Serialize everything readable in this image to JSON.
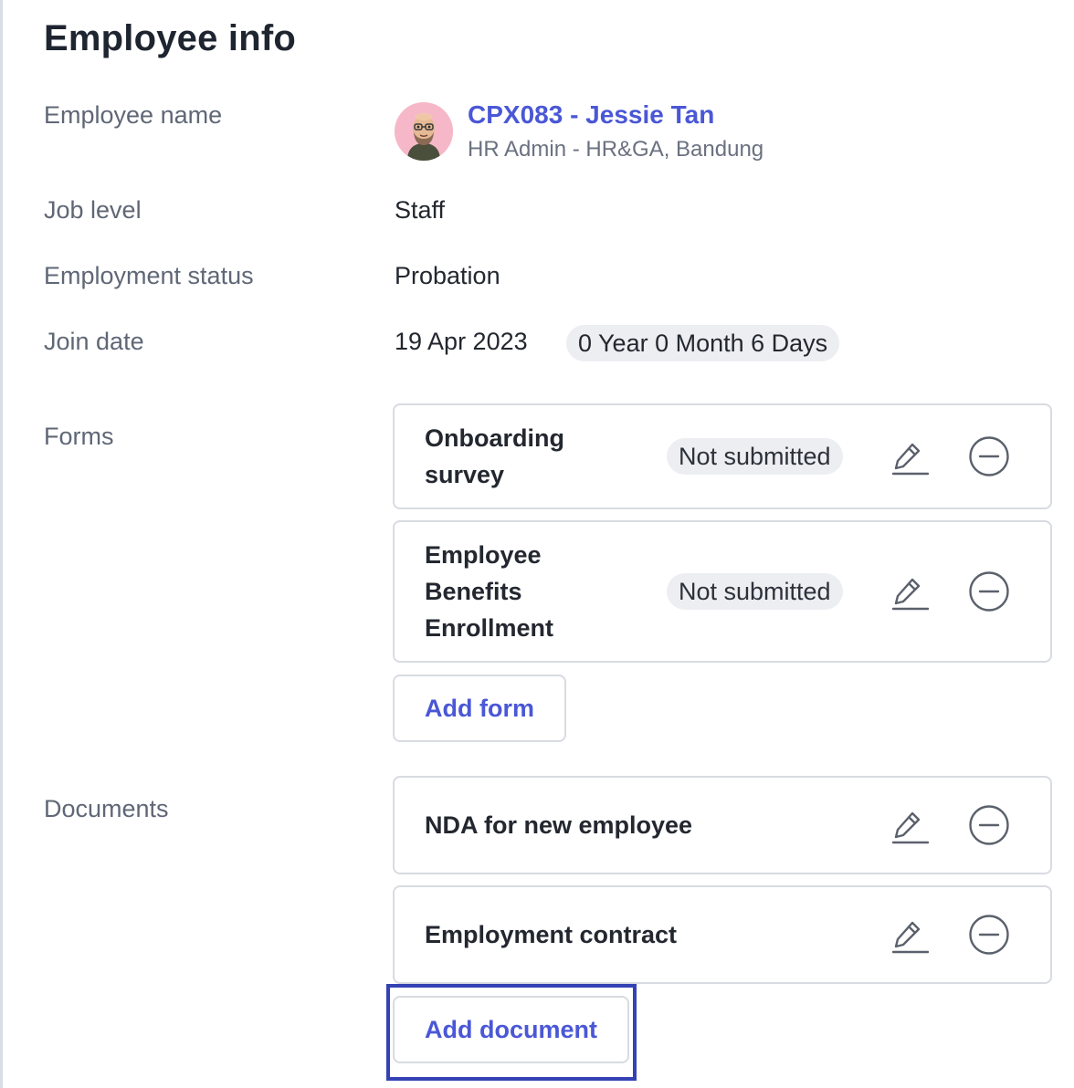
{
  "page_title": "Employee info",
  "accent_color": "#4a57d6",
  "fields": {
    "employee_name": {
      "label": "Employee name",
      "name": "CPX083 - Jessie Tan",
      "subtitle": "HR Admin - HR&GA, Bandung"
    },
    "job_level": {
      "label": "Job level",
      "value": "Staff"
    },
    "employment_status": {
      "label": "Employment status",
      "value": "Probation"
    },
    "join_date": {
      "label": "Join date",
      "value": "19 Apr 2023",
      "tenure": "0 Year 0 Month 6 Days"
    }
  },
  "forms": {
    "label": "Forms",
    "items": [
      {
        "title_lines": [
          "Onboarding",
          "survey"
        ],
        "status": "Not submitted",
        "edit_icon": "pencil-icon",
        "remove_icon": "minus-circle-icon"
      },
      {
        "title_lines": [
          "Employee",
          "Benefits",
          "Enrollment"
        ],
        "status": "Not submitted",
        "edit_icon": "pencil-icon",
        "remove_icon": "minus-circle-icon"
      }
    ],
    "add_label": "Add form"
  },
  "documents": {
    "label": "Documents",
    "items": [
      {
        "title": "NDA for new employee",
        "edit_icon": "pencil-icon",
        "remove_icon": "minus-circle-icon"
      },
      {
        "title": "Employment contract",
        "edit_icon": "pencil-icon",
        "remove_icon": "minus-circle-icon"
      }
    ],
    "add_label": "Add document"
  }
}
